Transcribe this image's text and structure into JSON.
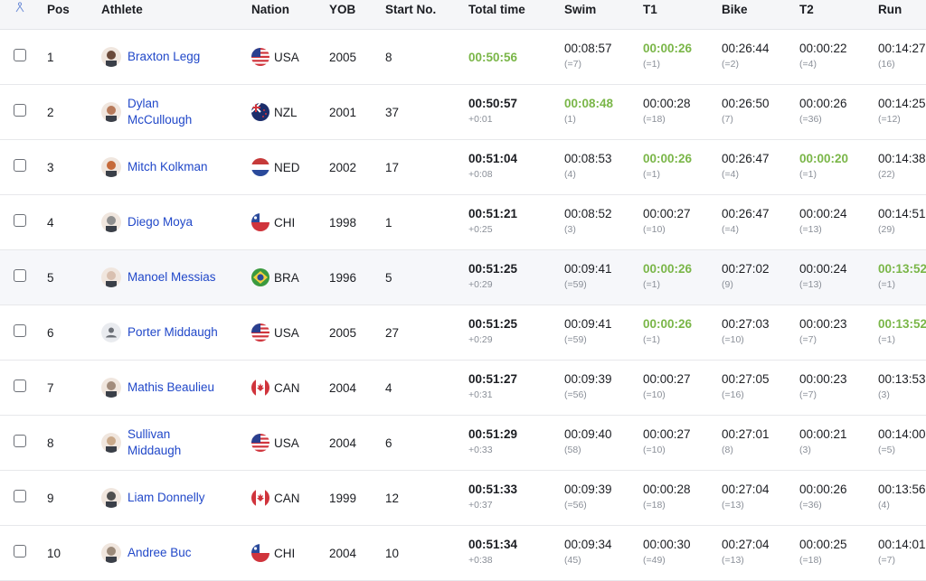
{
  "header": {
    "pos": "Pos",
    "athlete": "Athlete",
    "nation": "Nation",
    "yob": "YOB",
    "start": "Start No.",
    "total": "Total time",
    "swim": "Swim",
    "t1": "T1",
    "bike": "Bike",
    "t2": "T2",
    "run": "Run"
  },
  "rows": [
    {
      "pos": "1",
      "name": "Braxton Legg",
      "nation": "USA",
      "yob": "2005",
      "start": "8",
      "total": "00:50:56",
      "total_sub": "",
      "swim": "00:08:57",
      "swim_sub": "(=7)",
      "t1": "00:00:26",
      "t1_sub": "(=1)",
      "bike": "00:26:44",
      "bike_sub": "(=2)",
      "t2": "00:00:22",
      "t2_sub": "(=4)",
      "run": "00:14:27",
      "run_sub": "(16)"
    },
    {
      "pos": "2",
      "name": "Dylan McCullough",
      "nation": "NZL",
      "yob": "2001",
      "start": "37",
      "total": "00:50:57",
      "total_sub": "+0:01",
      "swim": "00:08:48",
      "swim_sub": "(1)",
      "t1": "00:00:28",
      "t1_sub": "(=18)",
      "bike": "00:26:50",
      "bike_sub": "(7)",
      "t2": "00:00:26",
      "t2_sub": "(=36)",
      "run": "00:14:25",
      "run_sub": "(=12)"
    },
    {
      "pos": "3",
      "name": "Mitch Kolkman",
      "nation": "NED",
      "yob": "2002",
      "start": "17",
      "total": "00:51:04",
      "total_sub": "+0:08",
      "swim": "00:08:53",
      "swim_sub": "(4)",
      "t1": "00:00:26",
      "t1_sub": "(=1)",
      "bike": "00:26:47",
      "bike_sub": "(=4)",
      "t2": "00:00:20",
      "t2_sub": "(=1)",
      "run": "00:14:38",
      "run_sub": "(22)"
    },
    {
      "pos": "4",
      "name": "Diego Moya",
      "nation": "CHI",
      "yob": "1998",
      "start": "1",
      "total": "00:51:21",
      "total_sub": "+0:25",
      "swim": "00:08:52",
      "swim_sub": "(3)",
      "t1": "00:00:27",
      "t1_sub": "(=10)",
      "bike": "00:26:47",
      "bike_sub": "(=4)",
      "t2": "00:00:24",
      "t2_sub": "(=13)",
      "run": "00:14:51",
      "run_sub": "(29)"
    },
    {
      "pos": "5",
      "name": "Manoel Messias",
      "nation": "BRA",
      "yob": "1996",
      "start": "5",
      "total": "00:51:25",
      "total_sub": "+0:29",
      "swim": "00:09:41",
      "swim_sub": "(=59)",
      "t1": "00:00:26",
      "t1_sub": "(=1)",
      "bike": "00:27:02",
      "bike_sub": "(9)",
      "t2": "00:00:24",
      "t2_sub": "(=13)",
      "run": "00:13:52",
      "run_sub": "(=1)"
    },
    {
      "pos": "6",
      "name": "Porter Middaugh",
      "nation": "USA",
      "yob": "2005",
      "start": "27",
      "total": "00:51:25",
      "total_sub": "+0:29",
      "swim": "00:09:41",
      "swim_sub": "(=59)",
      "t1": "00:00:26",
      "t1_sub": "(=1)",
      "bike": "00:27:03",
      "bike_sub": "(=10)",
      "t2": "00:00:23",
      "t2_sub": "(=7)",
      "run": "00:13:52",
      "run_sub": "(=1)"
    },
    {
      "pos": "7",
      "name": "Mathis Beaulieu",
      "nation": "CAN",
      "yob": "2004",
      "start": "4",
      "total": "00:51:27",
      "total_sub": "+0:31",
      "swim": "00:09:39",
      "swim_sub": "(=56)",
      "t1": "00:00:27",
      "t1_sub": "(=10)",
      "bike": "00:27:05",
      "bike_sub": "(=16)",
      "t2": "00:00:23",
      "t2_sub": "(=7)",
      "run": "00:13:53",
      "run_sub": "(3)"
    },
    {
      "pos": "8",
      "name": "Sullivan Middaugh",
      "nation": "USA",
      "yob": "2004",
      "start": "6",
      "total": "00:51:29",
      "total_sub": "+0:33",
      "swim": "00:09:40",
      "swim_sub": "(58)",
      "t1": "00:00:27",
      "t1_sub": "(=10)",
      "bike": "00:27:01",
      "bike_sub": "(8)",
      "t2": "00:00:21",
      "t2_sub": "(3)",
      "run": "00:14:00",
      "run_sub": "(=5)"
    },
    {
      "pos": "9",
      "name": "Liam Donnelly",
      "nation": "CAN",
      "yob": "1999",
      "start": "12",
      "total": "00:51:33",
      "total_sub": "+0:37",
      "swim": "00:09:39",
      "swim_sub": "(=56)",
      "t1": "00:00:28",
      "t1_sub": "(=18)",
      "bike": "00:27:04",
      "bike_sub": "(=13)",
      "t2": "00:00:26",
      "t2_sub": "(=36)",
      "run": "00:13:56",
      "run_sub": "(4)"
    },
    {
      "pos": "10",
      "name": "Andree Buc",
      "nation": "CHI",
      "yob": "2004",
      "start": "10",
      "total": "00:51:34",
      "total_sub": "+0:38",
      "swim": "00:09:34",
      "swim_sub": "(45)",
      "t1": "00:00:30",
      "t1_sub": "(=49)",
      "bike": "00:27:04",
      "bike_sub": "(=13)",
      "t2": "00:00:25",
      "t2_sub": "(=18)",
      "run": "00:14:01",
      "run_sub": "(=7)"
    }
  ],
  "colors": {
    "link": "#2148c9",
    "best": "#7ab648",
    "muted": "#8a8f98",
    "alt_row": "#f6f7fa"
  }
}
